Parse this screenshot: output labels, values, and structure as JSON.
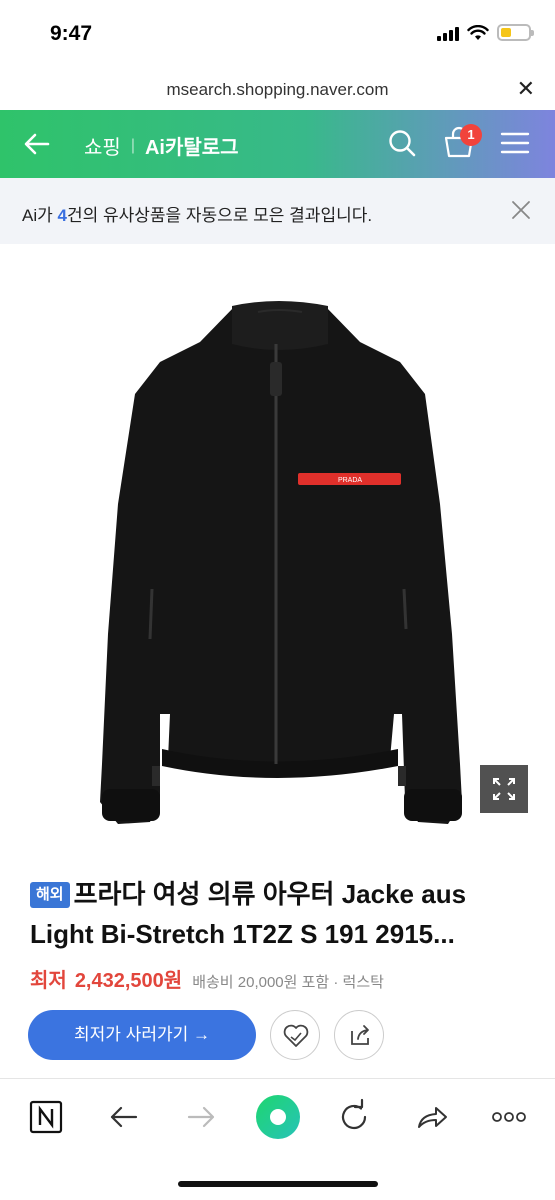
{
  "status_bar": {
    "time": "9:47"
  },
  "browser": {
    "url": "msearch.shopping.naver.com"
  },
  "nav": {
    "shopping": "쇼핑",
    "separator": "|",
    "catalog": "Ai카탈로그",
    "cart_count": "1"
  },
  "notice": {
    "prefix": "Ai가 ",
    "count": "4",
    "suffix": "건의 유사상품을 자동으로 모은 결과입니다."
  },
  "product": {
    "badge": "해외",
    "title": "프라다 여성 의류 아우터 Jacke aus Light Bi-Stretch 1T2Z S 191 2915...",
    "price_label": "최저",
    "price": "2,432,500원",
    "meta": "배송비 20,000원 포함 · 럭스탁",
    "brand_tag": "PRADA",
    "buy_label": "최저가 사러가기 →"
  },
  "colors": {
    "accent_blue": "#3b74e0",
    "price_red": "#e2463c",
    "badge_red": "#f1433c"
  }
}
